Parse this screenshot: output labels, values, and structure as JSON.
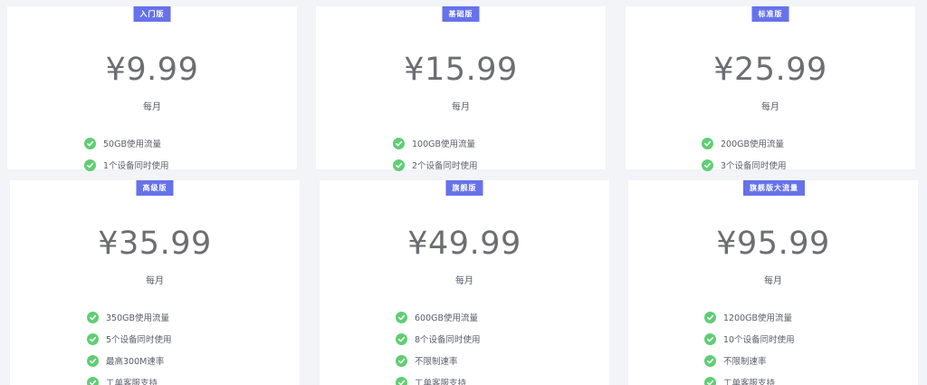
{
  "colors": {
    "page_bg": "#f3f4f8",
    "card_bg": "#ffffff",
    "badge_bg": "#6672ea",
    "check_green": "#5fce73",
    "price_text": "#6d6e72"
  },
  "plans": [
    {
      "badge": "入门版",
      "price": "¥9.99",
      "period": "每月",
      "features": [
        "50GB使用流量",
        "1个设备同时使用"
      ]
    },
    {
      "badge": "基础版",
      "price": "¥15.99",
      "period": "每月",
      "features": [
        "100GB使用流量",
        "2个设备同时使用"
      ]
    },
    {
      "badge": "标准版",
      "price": "¥25.99",
      "period": "每月",
      "features": [
        "200GB使用流量",
        "3个设备同时使用"
      ]
    },
    {
      "badge": "高级版",
      "price": "¥35.99",
      "period": "每月",
      "features": [
        "350GB使用流量",
        "5个设备同时使用",
        "最高300M速率",
        "工单客服支持"
      ]
    },
    {
      "badge": "旗舰版",
      "price": "¥49.99",
      "period": "每月",
      "features": [
        "600GB使用流量",
        "8个设备同时使用",
        "不限制速率",
        "工单客服支持"
      ]
    },
    {
      "badge": "旗舰版大流量",
      "price": "¥95.99",
      "period": "每月",
      "features": [
        "1200GB使用流量",
        "10个设备同时使用",
        "不限制速率",
        "工单客服支持"
      ]
    }
  ]
}
